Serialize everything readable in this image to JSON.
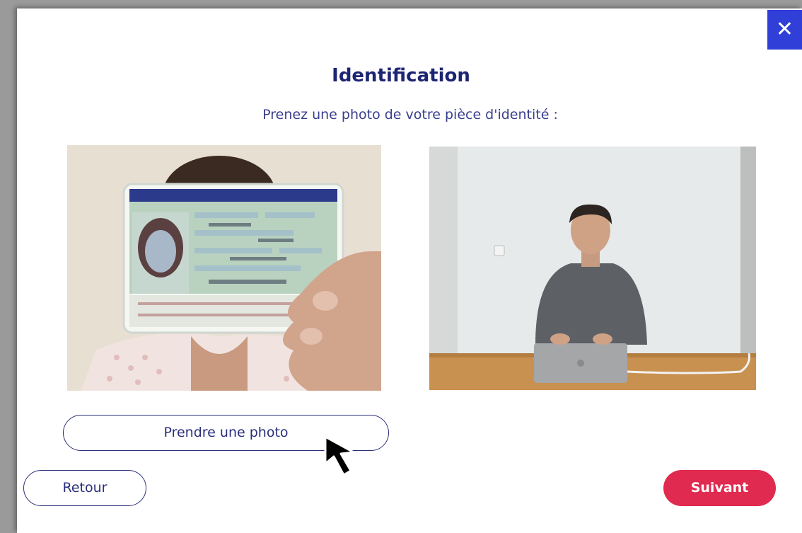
{
  "dialog": {
    "title": "Identification",
    "subtitle": "Prenez une photo de votre pièce d'identité :",
    "close_glyph": "✕"
  },
  "photos": {
    "id_card_preview": "photo of person holding identity card",
    "camera_feed": "live camera view of person at desk with laptop"
  },
  "buttons": {
    "take_photo": "Prendre une photo",
    "back": "Retour",
    "next": "Suivant"
  },
  "colors": {
    "title": "#1c2474",
    "accent_blue": "#2f3fd8",
    "next_button": "#e02a4f",
    "outline": "#2a2f7a"
  },
  "icons": {
    "close": "close-icon",
    "cursor": "mouse-pointer-icon"
  }
}
